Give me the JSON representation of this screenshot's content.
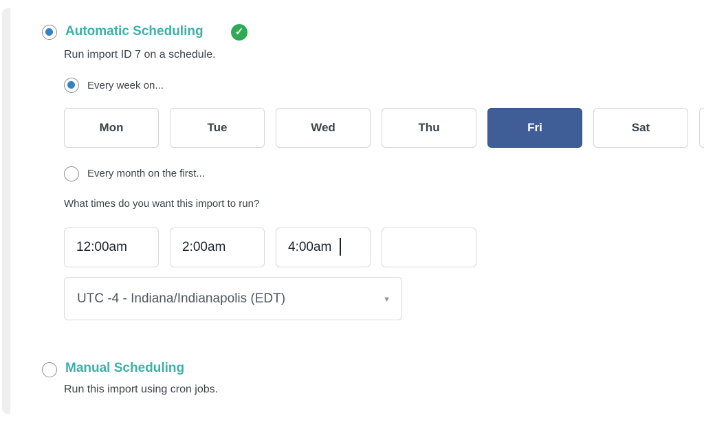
{
  "automatic": {
    "title": "Automatic Scheduling",
    "selected": true,
    "status_icon": "check-circle-icon",
    "description": "Run import ID 7 on a schedule.",
    "weekly": {
      "label": "Every week on...",
      "selected": true,
      "days": [
        {
          "label": "Mon",
          "selected": false
        },
        {
          "label": "Tue",
          "selected": false
        },
        {
          "label": "Wed",
          "selected": false
        },
        {
          "label": "Thu",
          "selected": false
        },
        {
          "label": "Fri",
          "selected": true
        },
        {
          "label": "Sat",
          "selected": false
        }
      ]
    },
    "monthly": {
      "label": "Every month on the first...",
      "selected": false
    },
    "times_label": "What times do you want this import to run?",
    "times": [
      "12:00am",
      "2:00am",
      "4:00am",
      ""
    ],
    "timezone": {
      "value": "UTC -4 - Indiana/Indianapolis (EDT)"
    },
    "check_glyph": "✓",
    "dropdown_glyph": "▼"
  },
  "manual": {
    "title": "Manual Scheduling",
    "selected": false,
    "description": "Run this import using cron jobs."
  },
  "colors": {
    "title_teal": "#3dafa8",
    "radio_blue": "#3582c4",
    "selected_day": "#3f5e98",
    "success_green": "#2faa55"
  }
}
